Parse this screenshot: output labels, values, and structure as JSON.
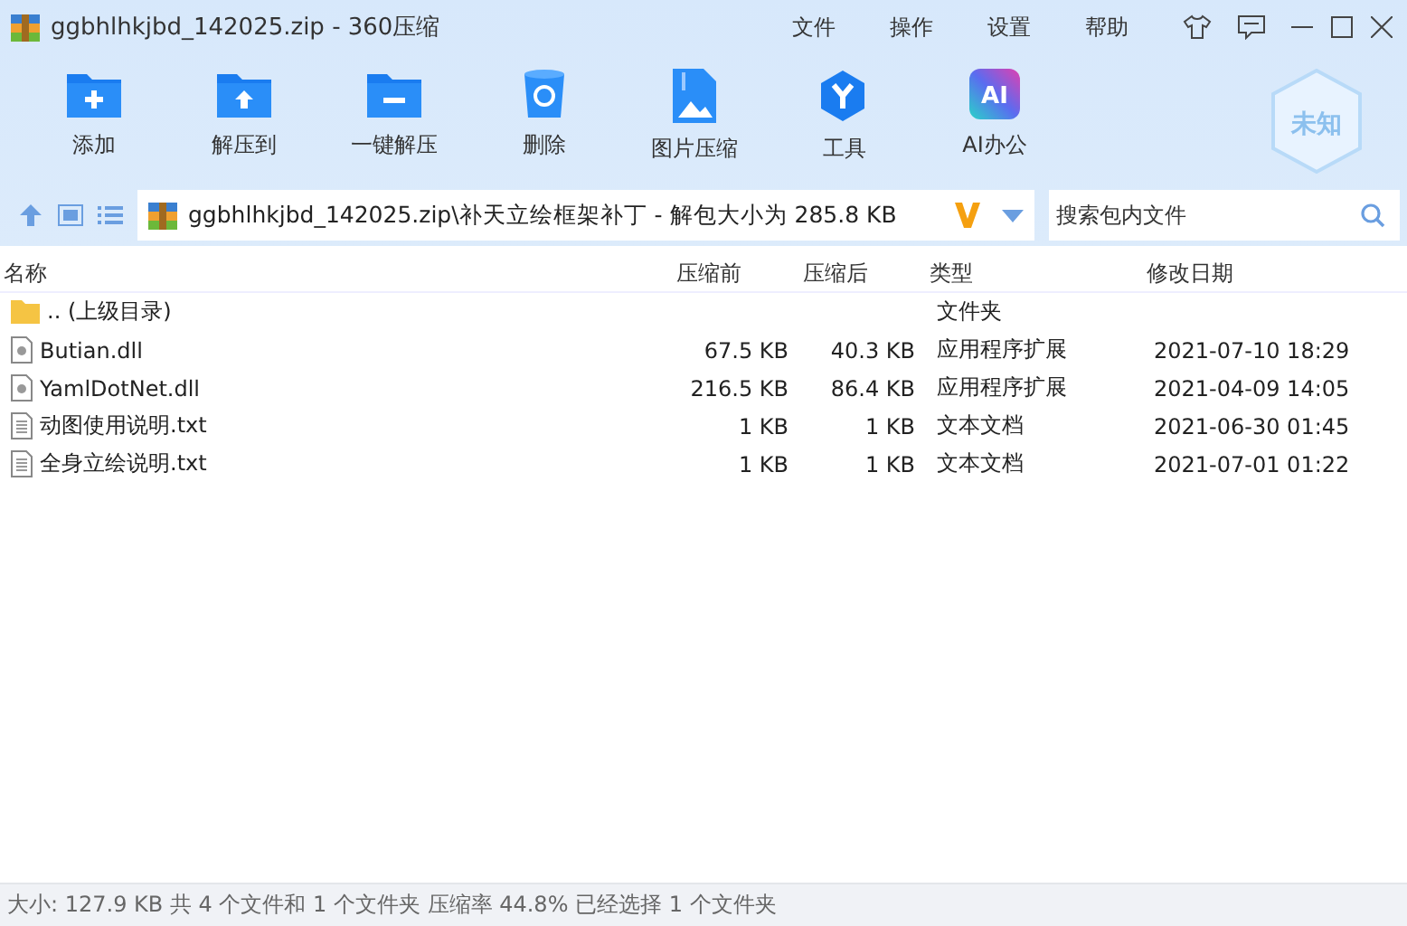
{
  "window": {
    "title": "ggbhlhkjbd_142025.zip - 360压缩"
  },
  "menu": [
    "文件",
    "操作",
    "设置",
    "帮助"
  ],
  "toolbar": [
    {
      "label": "添加",
      "kind": "add"
    },
    {
      "label": "解压到",
      "kind": "extract"
    },
    {
      "label": "一键解压",
      "kind": "oneclick"
    },
    {
      "label": "删除",
      "kind": "delete"
    },
    {
      "label": "图片压缩",
      "kind": "image"
    },
    {
      "label": "工具",
      "kind": "tools"
    },
    {
      "label": "AI办公",
      "kind": "ai",
      "badge": "AI"
    }
  ],
  "shield": "未知",
  "address": "ggbhlhkjbd_142025.zip\\补天立绘框架补丁 - 解包大小为 285.8 KB",
  "search": {
    "placeholder": "搜索包内文件"
  },
  "table": {
    "columns": [
      "名称",
      "压缩前",
      "压缩后",
      "类型",
      "修改日期"
    ],
    "rows": [
      {
        "kind": "folder",
        "name": ".. (上级目录)",
        "size": "",
        "packed": "",
        "type": "文件夹",
        "date": ""
      },
      {
        "kind": "dll",
        "name": "Butian.dll",
        "size": "67.5 KB",
        "packed": "40.3 KB",
        "type": "应用程序扩展",
        "date": "2021-07-10 18:29"
      },
      {
        "kind": "dll",
        "name": "YamlDotNet.dll",
        "size": "216.5 KB",
        "packed": "86.4 KB",
        "type": "应用程序扩展",
        "date": "2021-04-09 14:05"
      },
      {
        "kind": "txt",
        "name": "动图使用说明.txt",
        "size": "1 KB",
        "packed": "1 KB",
        "type": "文本文档",
        "date": "2021-06-30 01:45"
      },
      {
        "kind": "txt",
        "name": "全身立绘说明.txt",
        "size": "1 KB",
        "packed": "1 KB",
        "type": "文本文档",
        "date": "2021-07-01 01:22"
      }
    ]
  },
  "status_bar": "大小: 127.9 KB 共 4 个文件和 1 个文件夹 压缩率 44.8% 已经选择 1 个文件夹"
}
